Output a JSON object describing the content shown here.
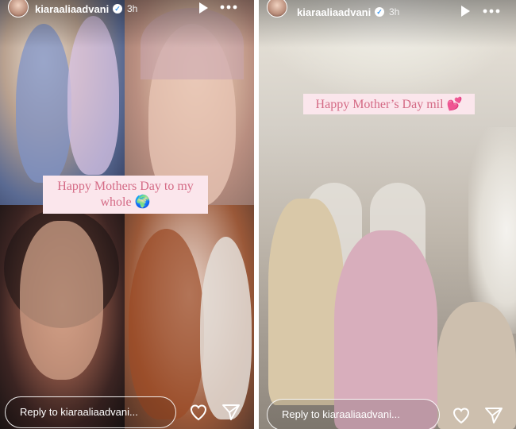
{
  "left_story": {
    "username": "kiaraaliaadvani",
    "time": "3h",
    "sticker_text": "Happy Mothers Day to my whole 🌍",
    "reply_placeholder": "Reply to kiaraaliaadvani..."
  },
  "right_story": {
    "username": "kiaraaliaadvani",
    "time": "3h",
    "sticker_text": "Happy Mother’s Day mil 💕",
    "reply_placeholder": "Reply to kiaraaliaadvani..."
  },
  "icons": {
    "verified": "verified-badge-icon",
    "play": "play-icon",
    "more": "more-options-icon",
    "like": "heart-icon",
    "share": "send-icon"
  },
  "colors": {
    "sticker_bg": "#fbe6ec",
    "sticker_text": "#d46a85",
    "verified_blue": "#3897f0"
  }
}
